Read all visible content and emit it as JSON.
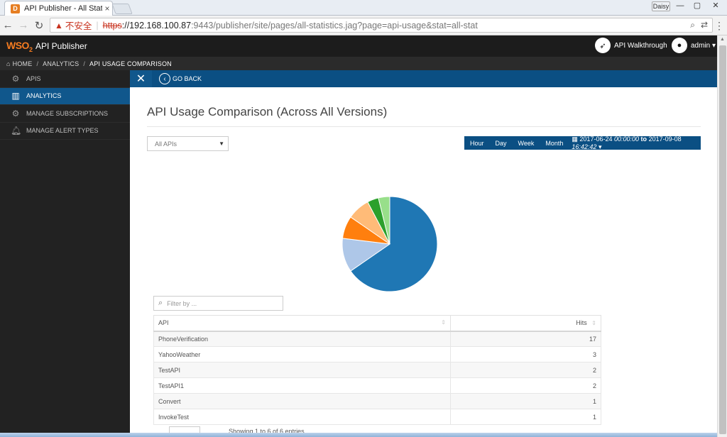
{
  "browser": {
    "tab_title": "API Publisher - All Stat",
    "tab_close": "×",
    "window_user": "Daisy",
    "window_controls": {
      "minimize": "—",
      "maximize": "▢",
      "close": "✕"
    },
    "nav": {
      "back": "←",
      "forward": "→",
      "reload": "↻"
    },
    "address": {
      "insecure_label": "不安全",
      "scheme": "https",
      "host": "://192.168.100.87",
      "path": ":9443/publisher/site/pages/all-statistics.jag?page=api-usage&stat=all-stat"
    }
  },
  "header": {
    "logo": "WSO",
    "logo_sub": "2",
    "app_name": "API Publisher",
    "walkthrough_label": "API Walkthrough",
    "user_label": "admin ▾"
  },
  "breadcrumb": {
    "items": [
      "HOME",
      "ANALYTICS",
      "API USAGE COMPARISON"
    ],
    "separator": "/"
  },
  "sidebar": {
    "items": [
      {
        "label": "APIS",
        "icon": "gear-icon",
        "active": false
      },
      {
        "label": "ANALYTICS",
        "icon": "chart-icon",
        "active": true
      },
      {
        "label": "MANAGE SUBSCRIPTIONS",
        "icon": "gear-icon",
        "active": false
      },
      {
        "label": "MANAGE ALERT TYPES",
        "icon": "bell-icon",
        "active": false
      }
    ]
  },
  "subbar": {
    "close_label": "✕",
    "goback_label": "GO BACK"
  },
  "main": {
    "title": "API Usage Comparison (Across All Versions)",
    "api_select": {
      "value": "All APIs",
      "caret": "▼"
    },
    "range": {
      "buttons": [
        "Hour",
        "Day",
        "Week",
        "Month"
      ],
      "from_date": "2017-06-24",
      "from_time": "00:00:00",
      "to_word": "to",
      "to_date": "2017-09-08",
      "to_time": "16:42:42"
    },
    "filter_placeholder": "Filter by ...",
    "table": {
      "columns": [
        "API",
        "Hits"
      ],
      "rows": [
        {
          "api": "PhoneVerification",
          "hits": "17"
        },
        {
          "api": "YahooWeather",
          "hits": "3"
        },
        {
          "api": "TestAPI",
          "hits": "2"
        },
        {
          "api": "TestAPI1",
          "hits": "2"
        },
        {
          "api": "Convert",
          "hits": "1"
        },
        {
          "api": "InvokeTest",
          "hits": "1"
        }
      ]
    },
    "footer_text": "Showing 1 to 6 of 6 entries"
  },
  "colors": {
    "header_bg": "#1c1c1c",
    "sidebar_bg": "#222222",
    "active_blue": "#10578c",
    "pie": [
      "#1f77b4",
      "#aec7e8",
      "#ff7f0e",
      "#ffbb78",
      "#2ca02c",
      "#98df8a"
    ]
  },
  "chart_data": {
    "type": "pie",
    "labels": [
      "PhoneVerification",
      "YahooWeather",
      "TestAPI",
      "TestAPI1",
      "Convert",
      "InvokeTest"
    ],
    "values": [
      17,
      3,
      2,
      2,
      1,
      1
    ]
  }
}
